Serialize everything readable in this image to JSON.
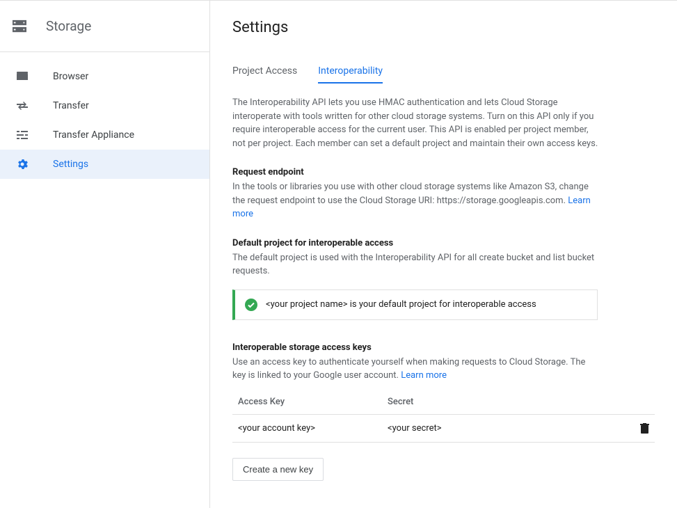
{
  "sidebar": {
    "title": "Storage",
    "items": [
      {
        "label": "Browser"
      },
      {
        "label": "Transfer"
      },
      {
        "label": "Transfer Appliance"
      },
      {
        "label": "Settings"
      }
    ]
  },
  "page": {
    "title": "Settings",
    "tabs": [
      {
        "label": "Project Access"
      },
      {
        "label": "Interoperability"
      }
    ],
    "intro": "The Interoperability API lets you use HMAC authentication and lets Cloud Storage interoperate with tools written for other cloud storage systems. Turn on this API only if you require interoperable access for the current user. This API is enabled per project member, not per project. Each member can set a default project and maintain their own access keys.",
    "endpoint": {
      "heading": "Request endpoint",
      "text": "In the tools or libraries you use with other cloud storage systems like Amazon S3, change the request endpoint to use the Cloud Storage URI: https://storage.googleapis.com. ",
      "learn": "Learn more"
    },
    "default_project": {
      "heading": "Default project for interoperable access",
      "text": "The default project is used with the Interoperability API for all create bucket and list bucket requests.",
      "callout_name": "<your project name>",
      "callout_suffix": " is your default project for interoperable access"
    },
    "keys": {
      "heading": "Interoperable storage access keys",
      "text": "Use an access key to authenticate yourself when making requests to Cloud Storage. The key is linked to your Google user account. ",
      "learn": "Learn more",
      "col_key": "Access Key",
      "col_secret": "Secret",
      "row_key": "<your account key>",
      "row_secret": "<your secret>",
      "create_btn": "Create a new key"
    }
  }
}
